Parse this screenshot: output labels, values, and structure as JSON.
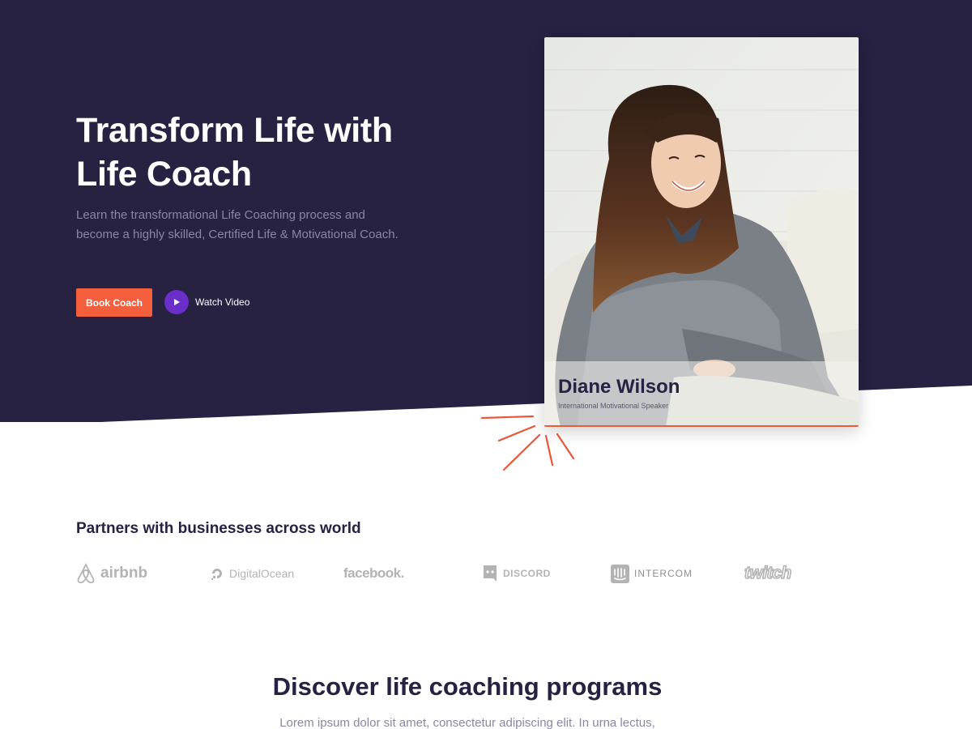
{
  "hero": {
    "title": "Transform Life with Life Coach",
    "subtitle": "Learn the transformational Life Coaching process and become a highly skilled, Certified Life & Motivational Coach.",
    "book_label": "Book Coach",
    "watch_label": "Watch Video"
  },
  "coach": {
    "name": "Diane Wilson",
    "role": "International Motivational Speaker"
  },
  "partners": {
    "title": "Partners with businesses across world",
    "logos": [
      "airbnb",
      "DigitalOcean",
      "facebook.",
      "DISCORD",
      "INTERCOM",
      "twitch"
    ]
  },
  "discover": {
    "title": "Discover life coaching programs",
    "subtitle": "Lorem ipsum dolor sit amet, consectetur adipiscing elit. In urna lectus,"
  },
  "colors": {
    "hero_bg": "#272142",
    "accent": "#f4603d",
    "play": "#6b2fc9"
  }
}
